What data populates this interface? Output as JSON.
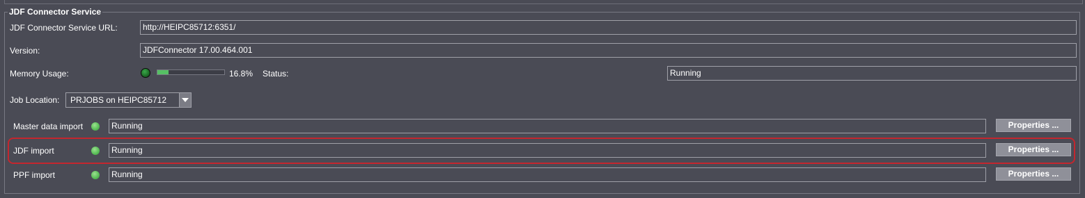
{
  "group": {
    "title": "JDF Connector Service"
  },
  "service": {
    "url_label": "JDF Connector Service URL:",
    "url_value": "http://HEIPC85712:6351/",
    "version_label": "Version:",
    "version_value": "JDFConnector 17.00.464.001",
    "memory_label": "Memory Usage:",
    "memory_fraction": 0.168,
    "memory_percent_text": "16.8%",
    "status_label": "Status:",
    "status_value": "Running"
  },
  "job_location": {
    "label": "Job Location:",
    "selected": "PRJOBS on HEIPC85712"
  },
  "imports": [
    {
      "label": "Master data import",
      "status": "Running",
      "button": "Properties ..."
    },
    {
      "label": "JDF import",
      "status": "Running",
      "button": "Properties ...",
      "highlighted": true
    },
    {
      "label": "PPF import",
      "status": "Running",
      "button": "Properties ..."
    }
  ],
  "colors": {
    "background": "#4a4b55",
    "status_green": "#5cc05a",
    "highlight_red": "#c4262e",
    "button_gray": "#8f9099"
  }
}
